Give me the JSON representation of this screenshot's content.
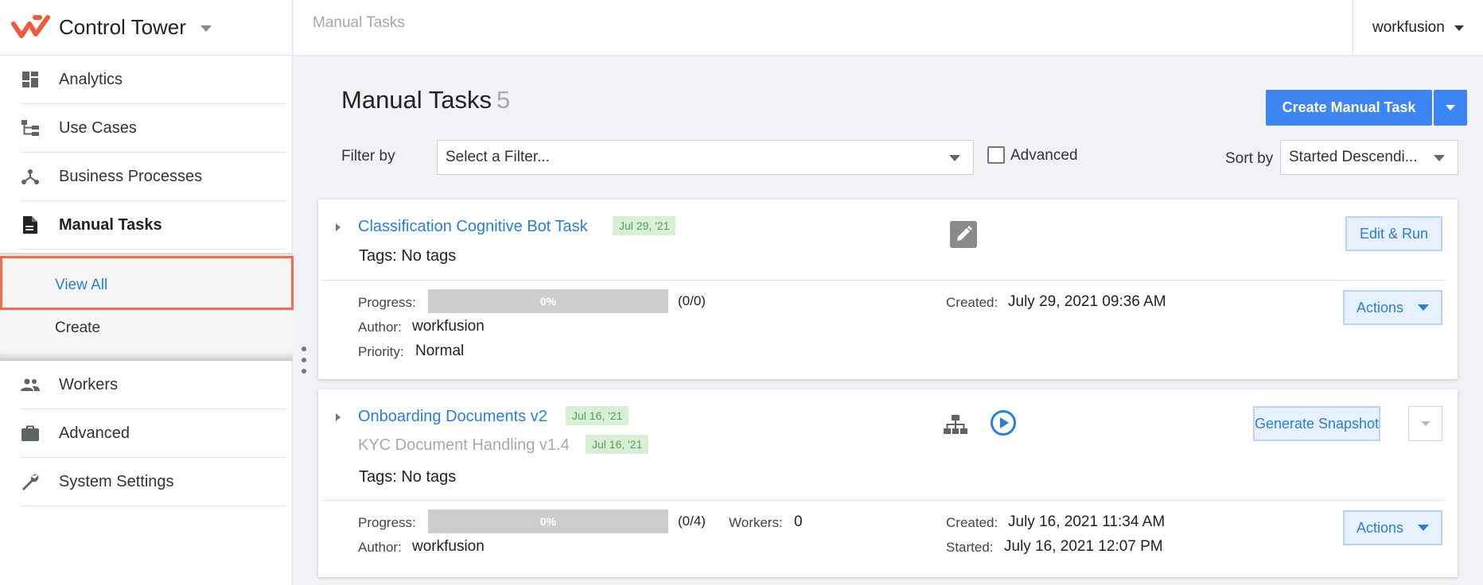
{
  "app": {
    "title": "Control Tower"
  },
  "sidebar": {
    "items": [
      {
        "label": "Analytics",
        "icon": "dashboard-icon"
      },
      {
        "label": "Use Cases",
        "icon": "hierarchy-icon"
      },
      {
        "label": "Business Processes",
        "icon": "process-icon"
      },
      {
        "label": "Manual Tasks",
        "icon": "document-icon",
        "active": true
      },
      {
        "label": "Workers",
        "icon": "people-icon"
      },
      {
        "label": "Advanced",
        "icon": "briefcase-icon"
      },
      {
        "label": "System Settings",
        "icon": "wrench-icon"
      }
    ],
    "submenu": [
      {
        "label": "View All",
        "active": true
      },
      {
        "label": "Create"
      }
    ]
  },
  "topbar": {
    "breadcrumb": "Manual Tasks",
    "user": "workfusion"
  },
  "page": {
    "title": "Manual Tasks",
    "count": "5",
    "create_button": "Create Manual Task",
    "filter_label": "Filter by",
    "filter_placeholder": "Select a Filter...",
    "advanced_label": "Advanced",
    "sort_label": "Sort by",
    "sort_value": "Started Descendi..."
  },
  "tasks": [
    {
      "title": "Classification Cognitive Bot Task",
      "date_badge": "Jul 29, '21",
      "tags": "Tags: No tags",
      "progress_label": "Progress:",
      "progress_percent": "0%",
      "progress_fraction": 0,
      "progress_count": "(0/0)",
      "author_label": "Author:",
      "author": "workfusion",
      "priority_label": "Priority:",
      "priority": "Normal",
      "created_label": "Created:",
      "created": "July 29, 2021 09:36 AM",
      "primary_button": "Edit & Run",
      "actions_button": "Actions"
    },
    {
      "title": "Onboarding Documents v2",
      "date_badge": "Jul 16, '21",
      "subtitle": "KYC Document Handling v1.4",
      "subtitle_badge": "Jul 16, '21",
      "tags": "Tags: No tags",
      "progress_label": "Progress:",
      "progress_percent": "0%",
      "progress_fraction": 0,
      "progress_count": "(0/4)",
      "workers_label": "Workers:",
      "workers": "0",
      "author_label": "Author:",
      "author": "workfusion",
      "created_label": "Created:",
      "created": "July 16, 2021 11:34 AM",
      "started_label": "Started:",
      "started": "July 16, 2021 12:07 PM",
      "primary_button": "Generate Snapshot",
      "actions_button": "Actions"
    }
  ],
  "colors": {
    "accent": "#3b86f2",
    "link": "#2a7de1",
    "brand_logo": "#f05a3a",
    "highlight": "#f26b4b",
    "badge_bg": "#d6efd5"
  }
}
